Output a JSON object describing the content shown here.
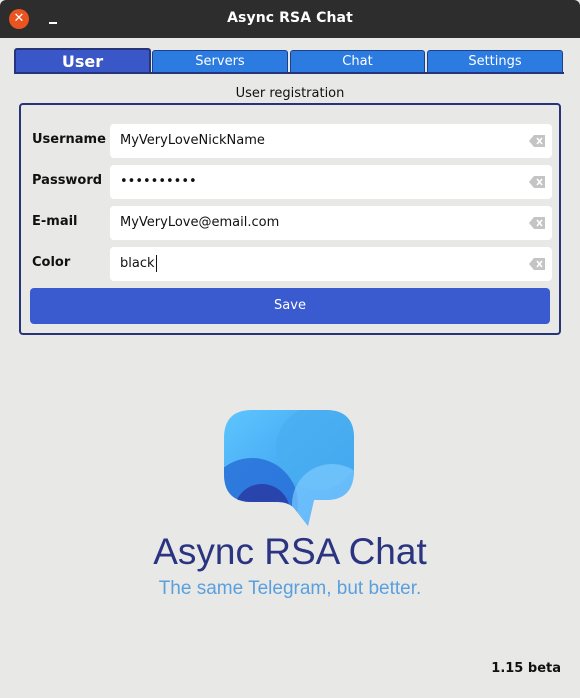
{
  "window": {
    "title": "Async RSA Chat",
    "close_glyph": "✕"
  },
  "tabs": [
    {
      "label": "User",
      "active": true
    },
    {
      "label": "Servers",
      "active": false
    },
    {
      "label": "Chat",
      "active": false
    },
    {
      "label": "Settings",
      "active": false
    }
  ],
  "form": {
    "section_title": "User registration",
    "fields": [
      {
        "label": "Username",
        "value": "MyVeryLoveNickName"
      },
      {
        "label": "Password",
        "value": "••••••••••"
      },
      {
        "label": "E-mail",
        "value": "MyVeryLove@email.com"
      },
      {
        "label": "Color",
        "value": "black"
      }
    ],
    "save_label": "Save"
  },
  "branding": {
    "title": "Async RSA Chat",
    "subtitle": "The same Telegram, but better."
  },
  "version": "1.15 beta",
  "colors": {
    "accent": "#3a5bd0",
    "tab": "#2b7be0",
    "brand_dark": "#2a3480",
    "brand_light": "#5aa0de"
  },
  "icons": [
    "close-icon",
    "minimize-icon",
    "clear-icon",
    "chat-bubble-logo-icon"
  ]
}
